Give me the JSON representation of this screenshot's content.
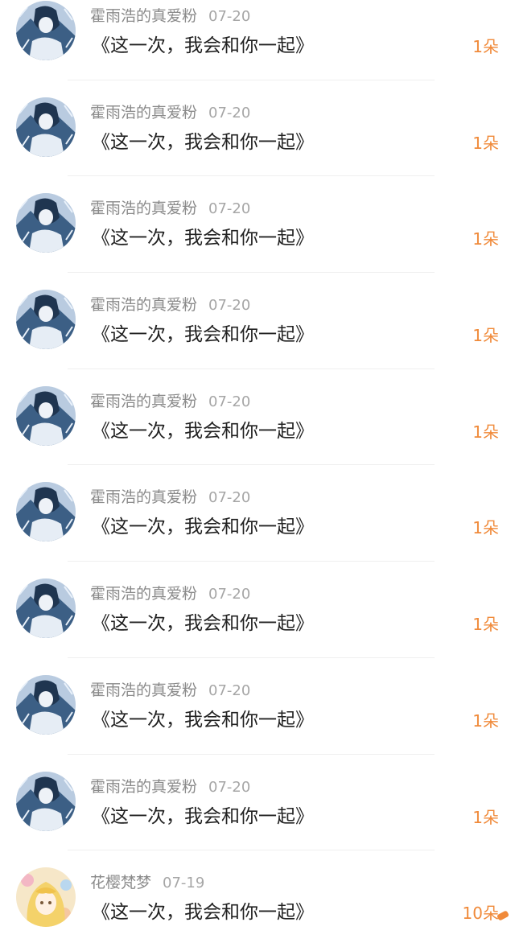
{
  "rows": [
    {
      "user": "霍雨浩的真爱粉",
      "date": "07-20",
      "title": "《这一次，我会和你一起》",
      "count": "1朵",
      "avatar_icon": "anime-avatar-icon-blue"
    },
    {
      "user": "霍雨浩的真爱粉",
      "date": "07-20",
      "title": "《这一次，我会和你一起》",
      "count": "1朵",
      "avatar_icon": "anime-avatar-icon-blue"
    },
    {
      "user": "霍雨浩的真爱粉",
      "date": "07-20",
      "title": "《这一次，我会和你一起》",
      "count": "1朵",
      "avatar_icon": "anime-avatar-icon-blue"
    },
    {
      "user": "霍雨浩的真爱粉",
      "date": "07-20",
      "title": "《这一次，我会和你一起》",
      "count": "1朵",
      "avatar_icon": "anime-avatar-icon-blue"
    },
    {
      "user": "霍雨浩的真爱粉",
      "date": "07-20",
      "title": "《这一次，我会和你一起》",
      "count": "1朵",
      "avatar_icon": "anime-avatar-icon-blue"
    },
    {
      "user": "霍雨浩的真爱粉",
      "date": "07-20",
      "title": "《这一次，我会和你一起》",
      "count": "1朵",
      "avatar_icon": "anime-avatar-icon-blue"
    },
    {
      "user": "霍雨浩的真爱粉",
      "date": "07-20",
      "title": "《这一次，我会和你一起》",
      "count": "1朵",
      "avatar_icon": "anime-avatar-icon-blue"
    },
    {
      "user": "霍雨浩的真爱粉",
      "date": "07-20",
      "title": "《这一次，我会和你一起》",
      "count": "1朵",
      "avatar_icon": "anime-avatar-icon-blue"
    },
    {
      "user": "霍雨浩的真爱粉",
      "date": "07-20",
      "title": "《这一次，我会和你一起》",
      "count": "1朵",
      "avatar_icon": "anime-avatar-icon-blue"
    },
    {
      "user": "花樱梵梦",
      "date": "07-19",
      "title": "《这一次，我会和你一起》",
      "count": "10朵",
      "avatar_icon": "anime-avatar-icon-blonde"
    }
  ],
  "colors": {
    "accent": "#f08a3a",
    "username": "#8a8a8a",
    "date": "#a6a6a6",
    "title": "#222222",
    "divider": "#efefef"
  }
}
